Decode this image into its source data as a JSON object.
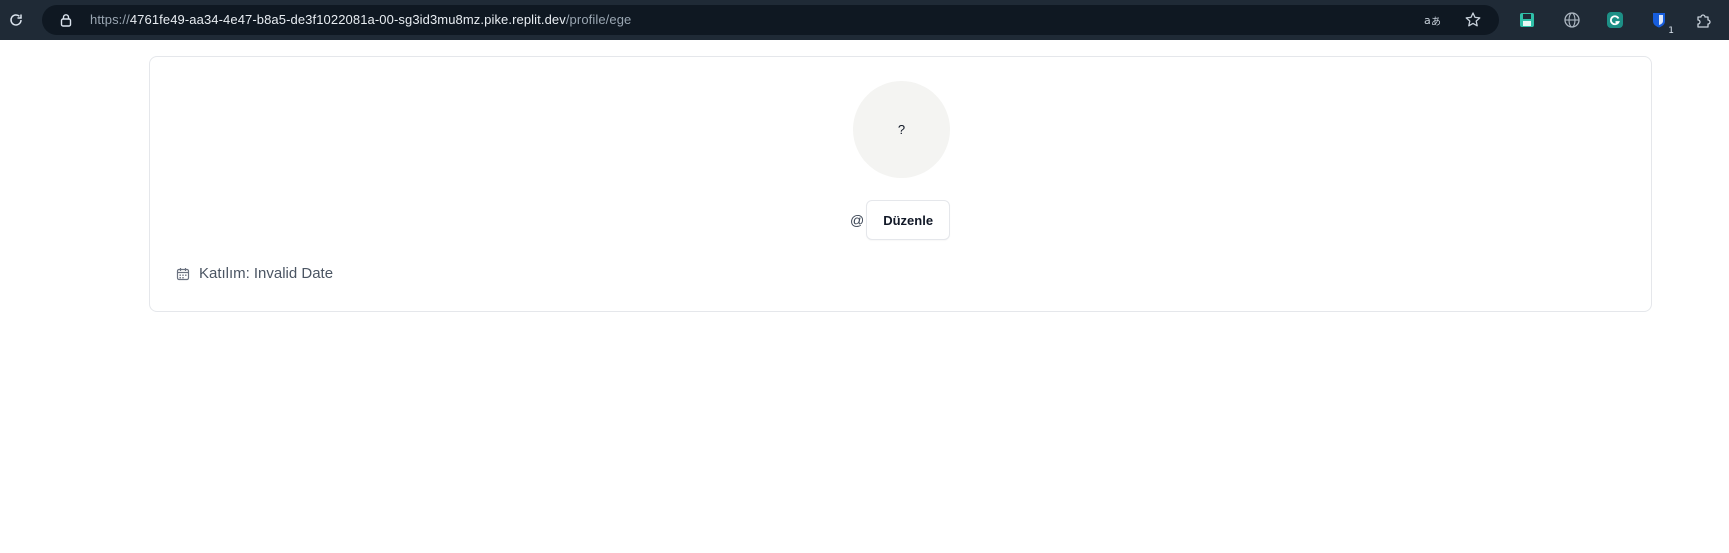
{
  "browser": {
    "url_scheme": "https://",
    "url_host": "4761fe49-aa34-4e47-b8a5-de3f1022081a-00-sg3id3mu8mz.pike.replit.dev",
    "url_path": "/profile/ege",
    "icons": {
      "reload": "reload-icon",
      "lock": "lock-icon",
      "translate": "translate-icon",
      "bookmark": "star-icon",
      "extensions": [
        "save-extension-icon",
        "globe-extension-icon",
        "grammarly-extension-icon",
        "bitwarden-extension-icon",
        "puzzle-extensions-icon"
      ]
    },
    "extension_badge": "1"
  },
  "profile": {
    "avatar_placeholder": "?",
    "handle_prefix": "@",
    "handle": "",
    "edit_label": "Düzenle",
    "joined_label": "Katılım:",
    "joined_value": "Invalid Date"
  },
  "colors": {
    "browser_bar": "#1f2a36",
    "omnibox": "#0f1822",
    "avatar_bg": "#f4f4f2",
    "card_border": "#e5e7eb"
  }
}
